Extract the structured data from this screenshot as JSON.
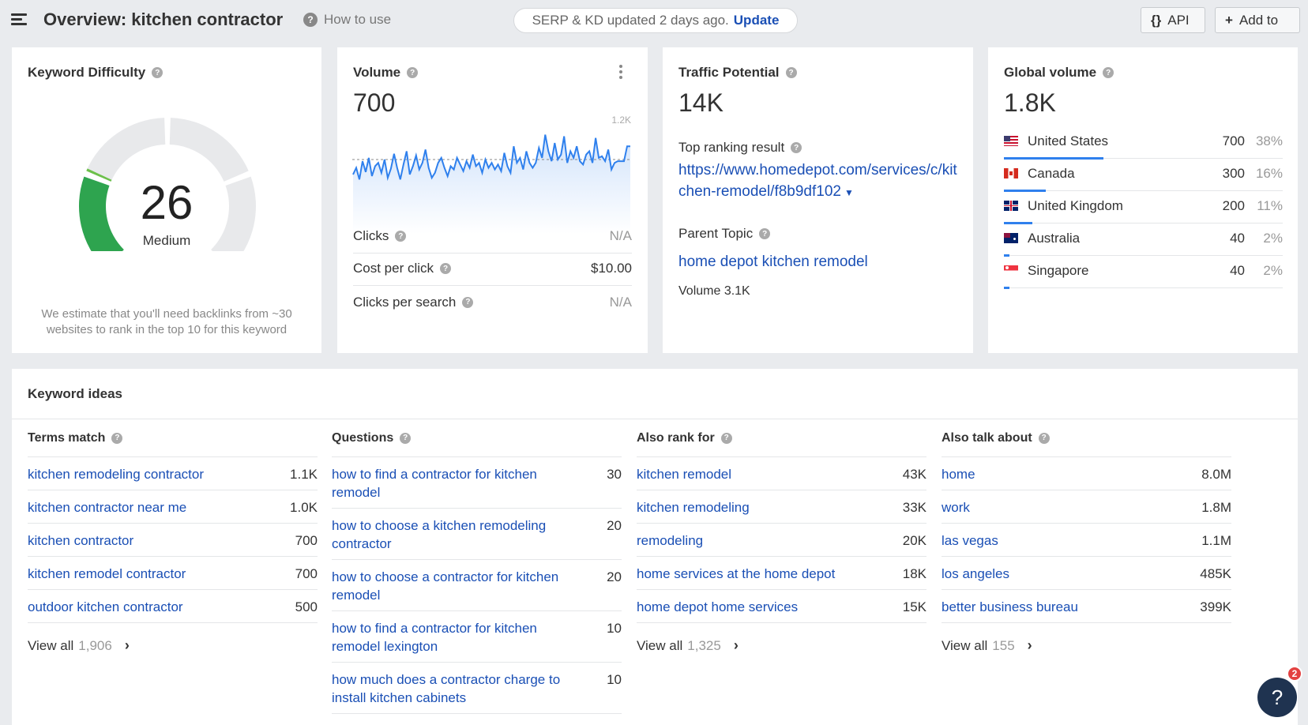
{
  "header": {
    "title": "Overview: kitchen contractor",
    "how_to_use": "How to use",
    "serp_notice": "SERP & KD updated 2 days ago.",
    "update_label": "Update",
    "api_label": "API",
    "add_to_label": "Add to"
  },
  "kd": {
    "title": "Keyword Difficulty",
    "value": "26",
    "level": "Medium",
    "note": "We estimate that you'll need backlinks from ~30 websites to rank in the top 10 for this keyword",
    "gauge_fraction": 0.26
  },
  "volume": {
    "title": "Volume",
    "value": "700",
    "chart_max_label": "1.2K",
    "chart_data": {
      "type": "line",
      "ylim": [
        0,
        1200
      ],
      "values": [
        620,
        700,
        560,
        780,
        650,
        820,
        600,
        720,
        760,
        640,
        800,
        580,
        690,
        870,
        700,
        560,
        740,
        900,
        620,
        720,
        850,
        680,
        760,
        920,
        700,
        580,
        640,
        760,
        820,
        700,
        600,
        720,
        680,
        820,
        740,
        660,
        780,
        700,
        860,
        720,
        760,
        640,
        800,
        700,
        760,
        680,
        740,
        660,
        880,
        720,
        640,
        960,
        760,
        820,
        680,
        900,
        760,
        700,
        760,
        940,
        820,
        1100,
        900,
        780,
        1000,
        800,
        860,
        1080,
        760,
        900,
        820,
        960,
        780,
        740,
        860,
        900,
        760,
        1060,
        820,
        840,
        780,
        920,
        680,
        760,
        780,
        780,
        780,
        960,
        960
      ],
      "average": 800
    },
    "rows": [
      {
        "label": "Clicks",
        "value": "N/A"
      },
      {
        "label": "Cost per click",
        "value": "$10.00"
      },
      {
        "label": "Clicks per search",
        "value": "N/A"
      }
    ]
  },
  "traffic": {
    "title": "Traffic Potential",
    "value": "14K",
    "top_result_label": "Top ranking result",
    "top_result_url": "https://www.homedepot.com/services/c/kitchen-remodel/f8b9df102",
    "parent_topic_label": "Parent Topic",
    "parent_topic": "home depot kitchen remodel",
    "parent_volume": "Volume 3.1K"
  },
  "global": {
    "title": "Global volume",
    "value": "1.8K",
    "countries": [
      {
        "name": "United States",
        "volume": "700",
        "pct": "38%",
        "share": 0.38,
        "flag": "us-flag-icon"
      },
      {
        "name": "Canada",
        "volume": "300",
        "pct": "16%",
        "share": 0.16,
        "flag": "ca-flag-icon"
      },
      {
        "name": "United Kingdom",
        "volume": "200",
        "pct": "11%",
        "share": 0.11,
        "flag": "uk-flag-icon"
      },
      {
        "name": "Australia",
        "volume": "40",
        "pct": "2%",
        "share": 0.02,
        "flag": "au-flag-icon"
      },
      {
        "name": "Singapore",
        "volume": "40",
        "pct": "2%",
        "share": 0.02,
        "flag": "sg-flag-icon"
      }
    ]
  },
  "ideas": {
    "title": "Keyword ideas",
    "view_all_label": "View all",
    "columns": [
      {
        "title": "Terms match",
        "rows": [
          {
            "kw": "kitchen remodeling contractor",
            "num": "1.1K"
          },
          {
            "kw": "kitchen contractor near me",
            "num": "1.0K"
          },
          {
            "kw": "kitchen contractor",
            "num": "700"
          },
          {
            "kw": "kitchen remodel contractor",
            "num": "700"
          },
          {
            "kw": "outdoor kitchen contractor",
            "num": "500"
          }
        ],
        "view_all_count": "1,906"
      },
      {
        "title": "Questions",
        "rows": [
          {
            "kw": "how to find a contractor for kitchen remodel",
            "num": "30"
          },
          {
            "kw": "how to choose a kitchen remodeling contractor",
            "num": "20"
          },
          {
            "kw": "how to choose a contractor for kitchen remodel",
            "num": "20"
          },
          {
            "kw": "how to find a contractor for kitchen remodel lexington",
            "num": "10"
          },
          {
            "kw": "how much does a contractor charge to install kitchen cabinets",
            "num": "10"
          }
        ],
        "view_all_count": ""
      },
      {
        "title": "Also rank for",
        "rows": [
          {
            "kw": "kitchen remodel",
            "num": "43K"
          },
          {
            "kw": "kitchen remodeling",
            "num": "33K"
          },
          {
            "kw": "remodeling",
            "num": "20K"
          },
          {
            "kw": "home services at the home depot",
            "num": "18K"
          },
          {
            "kw": "home depot home services",
            "num": "15K"
          }
        ],
        "view_all_count": "1,325"
      },
      {
        "title": "Also talk about",
        "rows": [
          {
            "kw": "home",
            "num": "8.0M"
          },
          {
            "kw": "work",
            "num": "1.8M"
          },
          {
            "kw": "las vegas",
            "num": "1.1M"
          },
          {
            "kw": "los angeles",
            "num": "485K"
          },
          {
            "kw": "better business bureau",
            "num": "399K"
          }
        ],
        "view_all_count": "155"
      }
    ]
  },
  "help": {
    "icon": "?",
    "badge": "2"
  },
  "colors": {
    "link": "#1a4fb5",
    "accent": "#2f80ed",
    "gauge_green": "#3aa84a"
  }
}
